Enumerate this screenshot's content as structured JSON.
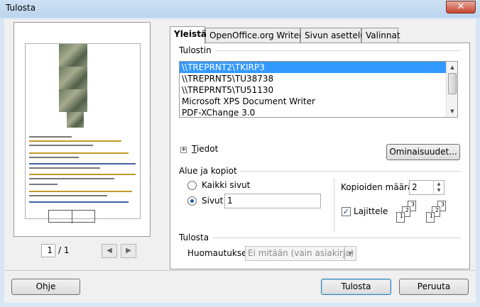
{
  "window": {
    "title": "Tulosta",
    "close_glyph": "✕"
  },
  "preview": {
    "page_number": "1",
    "page_total": "/ 1",
    "prev_glyph": "◀",
    "next_glyph": "▶"
  },
  "tabs": [
    {
      "label": "Yleistä",
      "active": true
    },
    {
      "label": "OpenOffice.org Writer",
      "active": false
    },
    {
      "label": "Sivun asettelu",
      "active": false
    },
    {
      "label": "Valinnat",
      "active": false
    }
  ],
  "printer": {
    "group_label": "Tulostin",
    "items": [
      "\\\\TREPRNT2\\TKIRP3",
      "\\\\TREPRNT5\\TU38738",
      "\\\\TREPRNT5\\TU51130",
      "Microsoft XPS Document Writer",
      "PDF-XChange 3.0"
    ],
    "selected_index": 0,
    "details_label": "Tiedot",
    "details_mnemonic": "T",
    "details_rest": "iedot",
    "properties_button": "Ominaisuudet..."
  },
  "range": {
    "group_label": "Alue ja kopiot",
    "all_pages_label": "Kaikki sivut",
    "all_pages_mnemonic": "s",
    "pages_label": "Sivut",
    "pages_value": "1",
    "selected": "pages",
    "copies_label": "Kopioiden määrä",
    "copies_value": "2",
    "collate_label": "Lajittele",
    "collate_checked": true,
    "collate_check_glyph": "✓"
  },
  "print": {
    "group_label": "Tulosta",
    "comments_label": "Huomautukset",
    "comments_value": "Ei mitään (vain asiakirja)",
    "comments_arrow": "▼"
  },
  "footer": {
    "help_button": "Ohje",
    "print_button": "Tulosta",
    "cancel_button": "Peruuta"
  },
  "colors": {
    "selection": "#3399ff",
    "titlebar": "#bcd4ee"
  }
}
